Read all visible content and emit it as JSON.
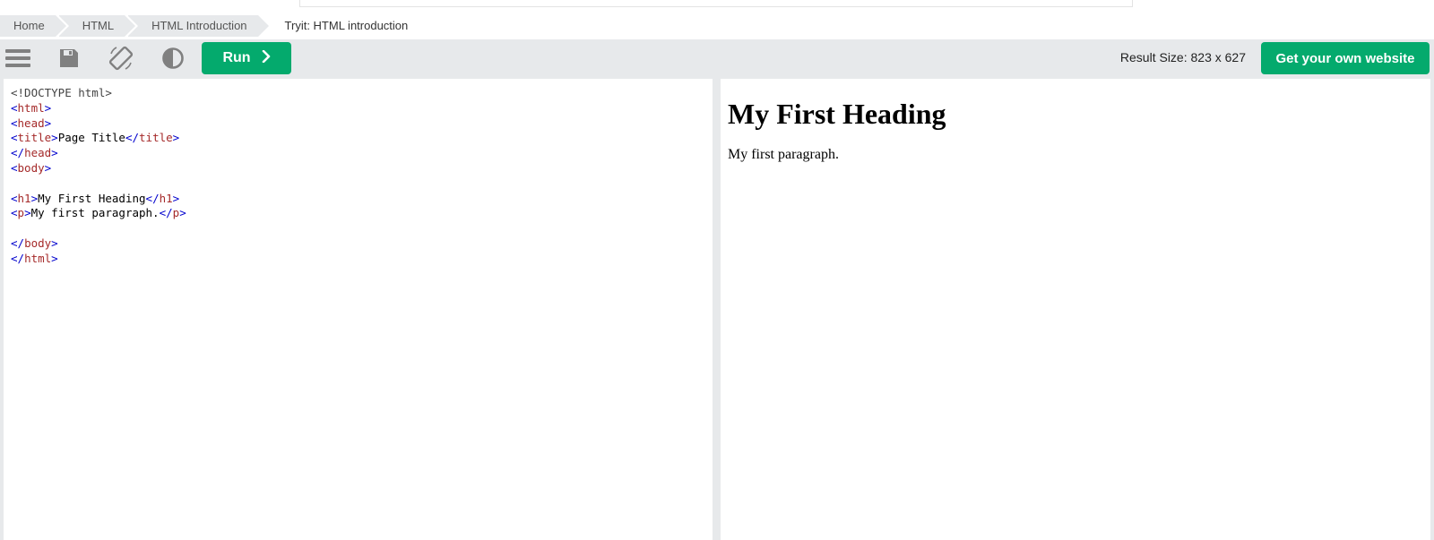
{
  "breadcrumb": {
    "items": [
      "Home",
      "HTML",
      "HTML Introduction"
    ],
    "current": "Tryit: HTML introduction"
  },
  "toolbar": {
    "icons": [
      "menu-icon",
      "save-icon",
      "rotate-icon",
      "contrast-icon"
    ],
    "run_label": "Run",
    "result_size_label": "Result Size: 823 x 627",
    "get_website_label": "Get your own website"
  },
  "colors": {
    "accent": "#04aa6d",
    "toolbar_bg": "#e7e9eb",
    "tag_bracket": "#0000cd",
    "tag_name": "#a52a2a"
  },
  "editor": {
    "lines": [
      "<!DOCTYPE html>",
      "<html>",
      "<head>",
      "<title>Page Title</title>",
      "</head>",
      "<body>",
      "",
      "<h1>My First Heading</h1>",
      "<p>My first paragraph.</p>",
      "",
      "</body>",
      "</html>"
    ]
  },
  "result": {
    "heading": "My First Heading",
    "paragraph": "My first paragraph."
  }
}
